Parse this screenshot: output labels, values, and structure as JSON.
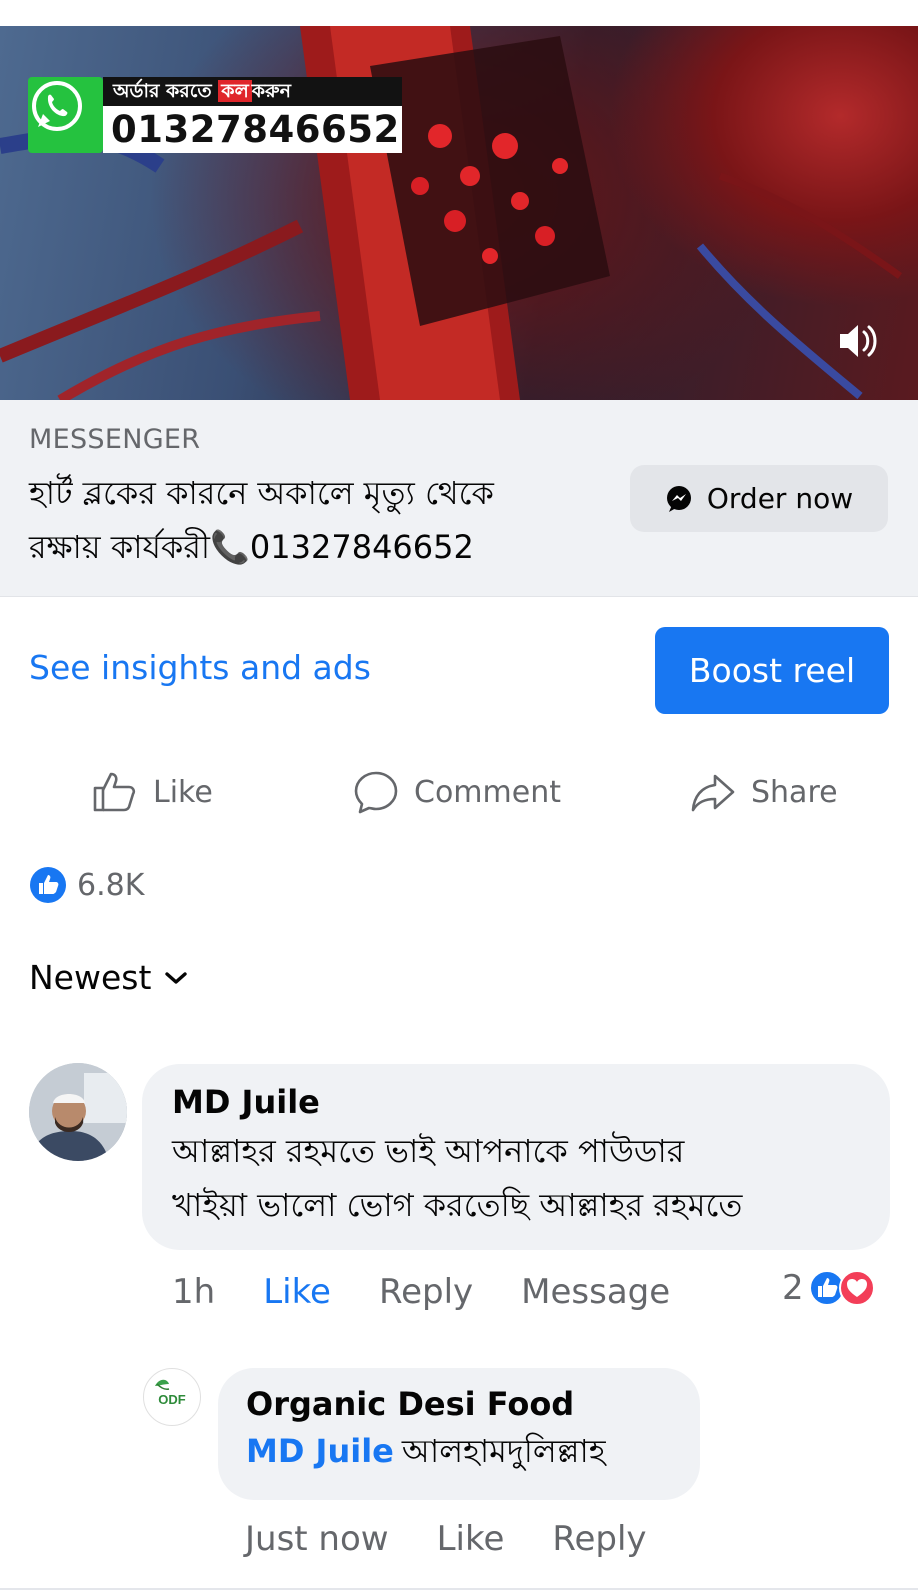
{
  "video": {
    "promo_top_before": "অর্ডার করতে",
    "promo_top_highlight": "কল",
    "promo_top_after": "করুন",
    "promo_phone": "01327846652",
    "sound_icon": "speaker-volume-icon",
    "whatsapp_icon": "whatsapp-icon"
  },
  "ad": {
    "source": "MESSENGER",
    "text_line1": "হার্ট ব্লকের কারনে অকালে মৃত্যু থেকে",
    "text_line2": "রক্ষায় কার্যকরী📞01327846652",
    "order_label": "Order now",
    "order_icon": "messenger-icon"
  },
  "insights": {
    "link_label": "See insights and ads",
    "boost_label": "Boost reel"
  },
  "actions": {
    "like": "Like",
    "comment": "Comment",
    "share": "Share"
  },
  "reactions": {
    "count": "6.8K"
  },
  "sort": {
    "label": "Newest"
  },
  "comments": [
    {
      "author": "MD Juile",
      "text_line1": "আল্লাহর রহমতে ভাই আপনাকে পাউডার",
      "text_line2": "খাইয়া ভালো ভোগ করতেছি আল্লাহর রহমতে",
      "time": "1h",
      "like": "Like",
      "reply": "Reply",
      "message": "Message",
      "reaction_count": "2"
    },
    {
      "author": "Organic Desi Food",
      "mention": "MD Juile",
      "text": "আলহামদুলিল্লাহ",
      "avatar_text": "ODF",
      "time": "Just now",
      "like": "Like",
      "reply": "Reply"
    }
  ],
  "colors": {
    "accent": "#1877f2",
    "secondary_text": "#65676b",
    "bubble": "#f0f2f5",
    "whatsapp": "#25c23f",
    "love": "#f33e58"
  }
}
